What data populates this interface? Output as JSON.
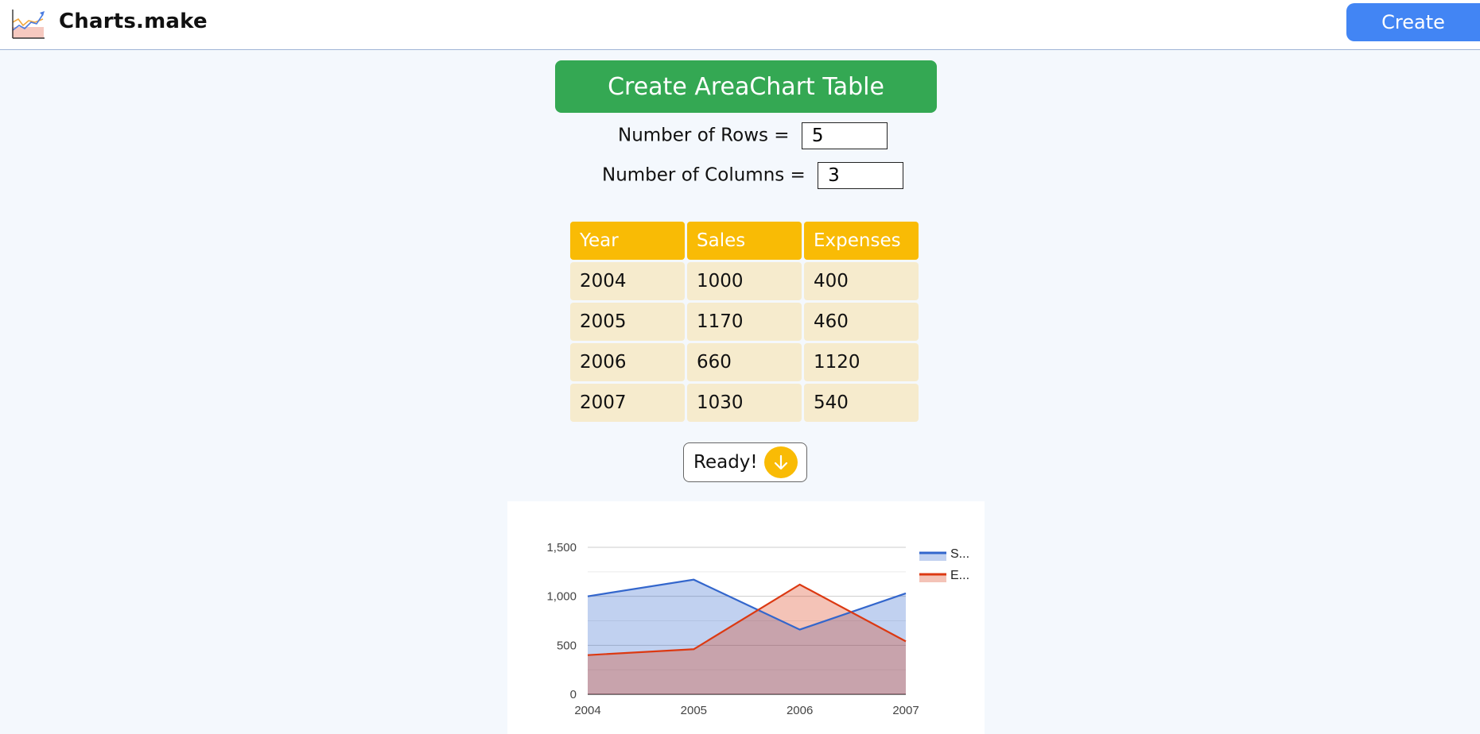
{
  "header": {
    "brand": "Charts.make",
    "create_label": "Create"
  },
  "builder": {
    "title_button": "Create AreaChart Table",
    "rows_label": "Number of Rows =",
    "rows_value": "5",
    "cols_label": "Number of Columns =",
    "cols_value": "3",
    "ready_label": "Ready!"
  },
  "table": {
    "headers": [
      "Year",
      "Sales",
      "Expenses"
    ],
    "rows": [
      [
        "2004",
        "1000",
        "400"
      ],
      [
        "2005",
        "1170",
        "460"
      ],
      [
        "2006",
        "660",
        "1120"
      ],
      [
        "2007",
        "1030",
        "540"
      ]
    ]
  },
  "colors": {
    "sales": "#3366cc",
    "expenses": "#dc3912",
    "create_button": "#4285f4",
    "table_button": "#34a853",
    "header_cell": "#f9bb05",
    "data_cell": "#f6ebcd"
  },
  "chart_data": {
    "type": "area",
    "title": "",
    "xlabel": "",
    "ylabel": "",
    "categories": [
      "2004",
      "2005",
      "2006",
      "2007"
    ],
    "series": [
      {
        "name": "S...",
        "values": [
          1000,
          1170,
          660,
          1030
        ],
        "color": "#3366cc"
      },
      {
        "name": "E...",
        "values": [
          400,
          460,
          1120,
          540
        ],
        "color": "#dc3912"
      }
    ],
    "ylim": [
      0,
      1500
    ],
    "yticks": [
      0,
      500,
      1000,
      1500
    ],
    "ytick_labels": [
      "0",
      "500",
      "1,000",
      "1,500"
    ],
    "grid": true,
    "legend": "right"
  }
}
